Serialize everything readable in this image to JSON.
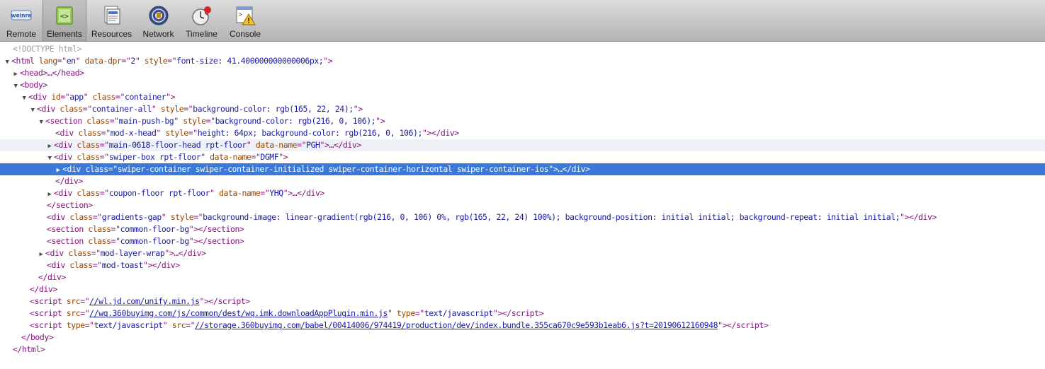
{
  "toolbar": {
    "items": [
      {
        "label": "Remote",
        "icon": "weinre-icon",
        "badge": "weinre"
      },
      {
        "label": "Elements",
        "icon": "elements-icon"
      },
      {
        "label": "Resources",
        "icon": "resources-icon"
      },
      {
        "label": "Network",
        "icon": "network-icon"
      },
      {
        "label": "Timeline",
        "icon": "timeline-icon"
      },
      {
        "label": "Console",
        "icon": "console-icon"
      }
    ]
  },
  "tree": {
    "doctype": "<!DOCTYPE html>",
    "html_open": {
      "lang": "en",
      "dpr": "2",
      "style": "font-size: 41.400000000000006px;"
    },
    "head": "head",
    "body": "body",
    "app": {
      "id": "app",
      "cls": "container"
    },
    "container_all": {
      "cls": "container-all",
      "style": "background-color: rgb(165, 22, 24);"
    },
    "main_push": {
      "cls": "main-push-bg",
      "style": "background-color: rgb(216, 0, 106);"
    },
    "mod_x_head": {
      "cls": "mod-x-head",
      "style": "height: 64px; background-color: rgb(216, 0, 106);"
    },
    "floor_head": {
      "cls": "main-0618-floor-head rpt-floor",
      "dname": "PGH"
    },
    "swiper_box": {
      "cls": "swiper-box rpt-floor",
      "dname": "DGMF"
    },
    "swiper_container": {
      "cls": "swiper-container swiper-container-initialized swiper-container-horizontal swiper-container-ios"
    },
    "coupon": {
      "cls": "coupon-floor rpt-floor",
      "dname": "YHQ"
    },
    "gradients": {
      "cls": "gradients-gap",
      "style": "background-image: linear-gradient(rgb(216, 0, 106) 0%, rgb(165, 22, 24) 100%); background-position: initial initial; background-repeat: initial initial;"
    },
    "common1": {
      "cls": "common-floor-bg"
    },
    "common2": {
      "cls": "common-floor-bg"
    },
    "layer": {
      "cls": "mod-layer-wrap"
    },
    "toast": {
      "cls": "mod-toast"
    },
    "script1": {
      "src": "//wl.jd.com/unify.min.js"
    },
    "script2": {
      "src": "//wq.360buyimg.com/js/common/dest/wq.imk.downloadAppPlugin.min.js",
      "type": "text/javascript"
    },
    "script3": {
      "type": "text/javascript",
      "src": "//storage.360buyimg.com/babel/00414006/974419/production/dev/index.bundle.355ca670c9e593b1eab6.js?t=20190612160948"
    }
  },
  "colors": {
    "selection": "#3879d9",
    "tag": "#881280",
    "attr_name": "#994500",
    "attr_value": "#1a1aa6"
  }
}
